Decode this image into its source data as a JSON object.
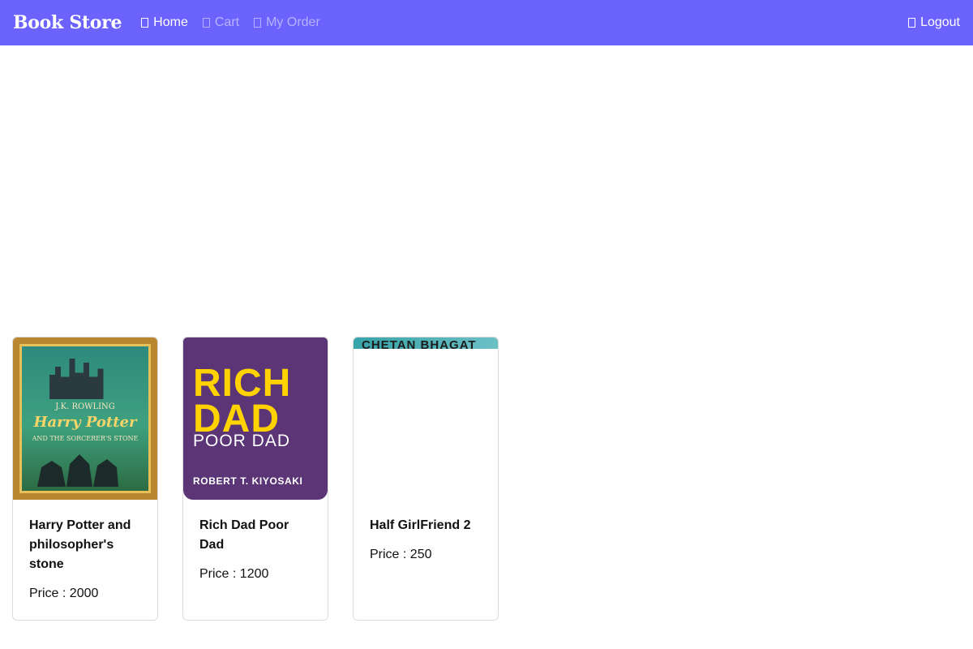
{
  "nav": {
    "brand": "Book Store",
    "links": [
      {
        "label": "Home",
        "icon": "home-icon"
      },
      {
        "label": "Cart",
        "icon": "cart-icon"
      },
      {
        "label": "My Order",
        "icon": "order-icon"
      }
    ],
    "logout": {
      "label": "Logout",
      "icon": "logout-icon"
    },
    "colors": {
      "bar": "#6c63ff",
      "active": "#ffffff",
      "muted": "#b7b2ff"
    }
  },
  "books": [
    {
      "title": "Harry Potter and philosopher's stone",
      "price": "Price : 2000",
      "cover": {
        "author": "J.K. ROWLING",
        "title": "Harry Potter",
        "subtitle": "AND THE SORCERER'S STONE"
      }
    },
    {
      "title": "Rich Dad Poor Dad",
      "price": "Price : 1200",
      "cover": {
        "line1": "RICH",
        "line2": "DAD",
        "line3": "POOR DAD",
        "author": "ROBERT T. KIYOSAKI"
      }
    },
    {
      "title": "Half GirlFriend 2",
      "price": "Price : 250",
      "cover": {
        "author": "CHETAN BHAGAT"
      }
    }
  ]
}
